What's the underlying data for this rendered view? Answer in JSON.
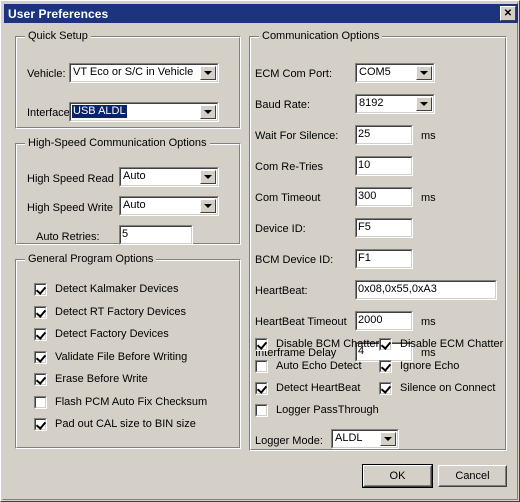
{
  "window": {
    "title": "User Preferences",
    "close_label": "✕"
  },
  "quick_setup": {
    "legend": "Quick Setup",
    "vehicle_label": "Vehicle:",
    "vehicle_value": "VT Eco or S/C in Vehicle",
    "interface_label": "Interface:",
    "interface_value": "USB ALDL"
  },
  "high_speed": {
    "legend": "High-Speed Communication Options",
    "read_label": "High Speed Read",
    "read_value": "Auto",
    "write_label": "High Speed Write",
    "write_value": "Auto",
    "retries_label": "Auto Retries:",
    "retries_value": "5"
  },
  "general_options": {
    "legend": "General Program Options",
    "items": [
      {
        "label": "Detect Kalmaker Devices",
        "checked": true
      },
      {
        "label": "Detect RT Factory Devices",
        "checked": true
      },
      {
        "label": "Detect Factory Devices",
        "checked": true
      },
      {
        "label": "Validate File Before Writing",
        "checked": true
      },
      {
        "label": "Erase Before Write",
        "checked": true
      },
      {
        "label": "Flash PCM Auto Fix Checksum",
        "checked": false
      },
      {
        "label": "Pad out CAL size to BIN size",
        "checked": true
      }
    ]
  },
  "communication": {
    "legend": "Communication Options",
    "fields": [
      {
        "label": "ECM Com Port:",
        "value": "COM5",
        "type": "combo",
        "unit": ""
      },
      {
        "label": "Baud Rate:",
        "value": "8192",
        "type": "combo",
        "unit": ""
      },
      {
        "label": "Wait For Silence:",
        "value": "25",
        "type": "text",
        "unit": "ms"
      },
      {
        "label": "Com Re-Tries",
        "value": "10",
        "type": "text",
        "unit": ""
      },
      {
        "label": "Com Timeout",
        "value": "300",
        "type": "text",
        "unit": "ms"
      },
      {
        "label": "Device ID:",
        "value": "F5",
        "type": "text",
        "unit": ""
      },
      {
        "label": "BCM Device ID:",
        "value": "F1",
        "type": "text",
        "unit": ""
      },
      {
        "label": "HeartBeat:",
        "value": "0x08,0x55,0xA3",
        "type": "text-wide",
        "unit": ""
      },
      {
        "label": "HeartBeat Timeout",
        "value": "2000",
        "type": "text",
        "unit": "ms"
      },
      {
        "label": "Interframe Delay",
        "value": "4",
        "type": "text",
        "unit": "ms"
      }
    ],
    "checks_left": [
      {
        "label": "Disable BCM Chatter",
        "checked": true
      },
      {
        "label": "Auto Echo Detect",
        "checked": false
      },
      {
        "label": "Detect HeartBeat",
        "checked": true
      },
      {
        "label": "Logger PassThrough",
        "checked": false
      }
    ],
    "checks_right": [
      {
        "label": "Disable ECM Chatter",
        "checked": true
      },
      {
        "label": "Ignore Echo",
        "checked": true
      },
      {
        "label": "Silence on Connect",
        "checked": true
      }
    ],
    "logger_mode_label": "Logger Mode:",
    "logger_mode_value": "ALDL"
  },
  "buttons": {
    "ok": "OK",
    "cancel": "Cancel"
  },
  "colors": {
    "titlebar": "#1c3380",
    "face": "#d4d0c8",
    "highlight": "#0a246a"
  }
}
